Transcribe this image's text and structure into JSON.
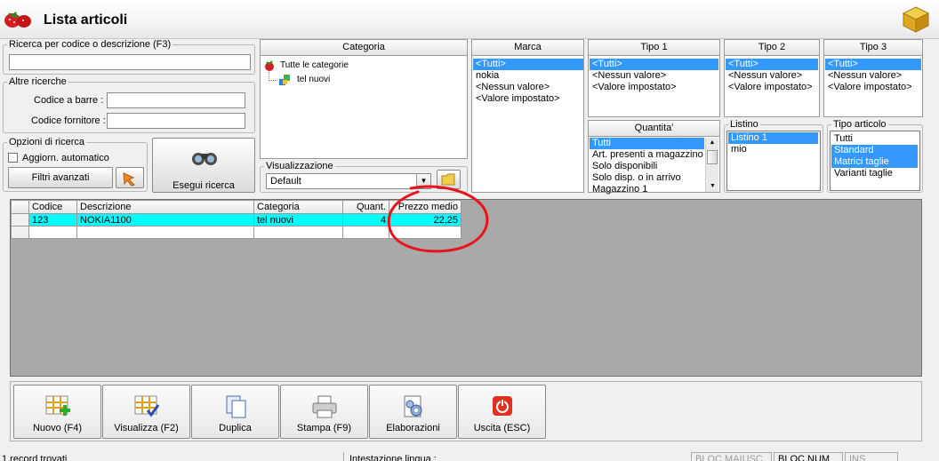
{
  "window": {
    "title": "Lista articoli"
  },
  "search": {
    "legend": "Ricerca per codice o descrizione (F3)",
    "value": "",
    "other_legend": "Altre ricerche",
    "barcode_label": "Codice a barre :",
    "supplier_label": "Codice fornitore :",
    "options_legend": "Opzioni di ricerca",
    "auto_update_label": "Aggiorn. automatico",
    "advanced_filters_label": "Filtri avanzati",
    "run_search_label": "Esegui ricerca"
  },
  "categoria": {
    "header": "Categoria",
    "root": "Tutte le categorie",
    "child": "tel nuovi"
  },
  "visualizzazione": {
    "legend": "Visualizzazione",
    "value": "Default"
  },
  "marca": {
    "header": "Marca",
    "items": [
      "<Tutti>",
      "nokia",
      "<Nessun valore>",
      "<Valore impostato>"
    ],
    "selected": 0
  },
  "tipo1": {
    "header": "Tipo 1",
    "items": [
      "<Tutti>",
      "<Nessun valore>",
      "<Valore impostato>"
    ],
    "selected": 0
  },
  "tipo2": {
    "header": "Tipo 2",
    "items": [
      "<Tutti>",
      "<Nessun valore>",
      "<Valore impostato>"
    ],
    "selected": 0
  },
  "tipo3": {
    "header": "Tipo 3",
    "items": [
      "<Tutti>",
      "<Nessun valore>",
      "<Valore impostato>"
    ],
    "selected": 0
  },
  "quantita": {
    "header": "Quantita'",
    "items": [
      "Tutti",
      "Art. presenti a magazzino",
      "Solo disponibili",
      "Solo disp. o in arrivo",
      "Magazzino 1"
    ],
    "selected": 0
  },
  "listino": {
    "legend": "Listino",
    "items": [
      "Listino 1",
      "mio"
    ],
    "selected": 0
  },
  "tipo_articolo": {
    "legend": "Tipo articolo",
    "items": [
      "Tutti",
      "Standard",
      "Matrici taglie",
      "Varianti taglie"
    ],
    "selected": [
      1,
      2
    ]
  },
  "table": {
    "columns": [
      "Codice",
      "Descrizione",
      "Categoria",
      "Quant.",
      "Prezzo medio"
    ],
    "rows": [
      {
        "codice": "123",
        "descrizione": "NOKIA1100",
        "categoria": "tel nuovi",
        "quant": "4",
        "prezzo": "22,25"
      }
    ]
  },
  "toolbar": {
    "nuovo": "Nuovo (F4)",
    "visualizza": "Visualizza (F2)",
    "duplica": "Duplica",
    "stampa": "Stampa (F9)",
    "elaborazioni": "Elaborazioni",
    "uscita": "Uscita (ESC)"
  },
  "statusbar": {
    "records": "1 record trovati",
    "intestazione": "Intestazione lingua :",
    "caps": "BLOC MAIUSC",
    "num": "BLOC NUM",
    "ins": "INS"
  },
  "colors": {
    "selection": "#3399ff",
    "row_highlight": "#00ffff",
    "annotation": "#e8141c",
    "grid_bg": "#a9a9a9"
  }
}
